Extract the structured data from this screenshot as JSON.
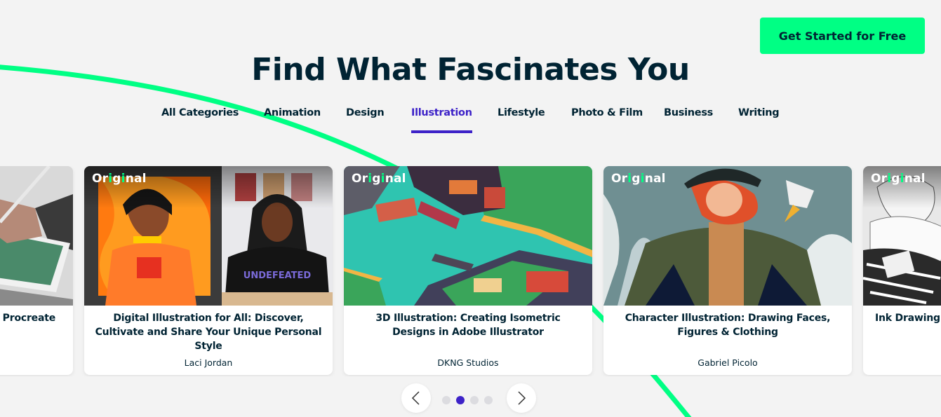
{
  "header": {
    "cta_label": "Get Started for Free",
    "title": "Find What Fascinates You"
  },
  "tabs": [
    {
      "label": "All Categories",
      "active": false
    },
    {
      "label": "Animation",
      "active": false
    },
    {
      "label": "Design",
      "active": false
    },
    {
      "label": "Illustration",
      "active": true
    },
    {
      "label": "Lifestyle",
      "active": false
    },
    {
      "label": "Photo & Film",
      "active": false
    },
    {
      "label": "Business",
      "active": false
    },
    {
      "label": "Writing",
      "active": false
    }
  ],
  "badge": {
    "label": "Original"
  },
  "cards": [
    {
      "title": "… Procreate",
      "author": "",
      "badge": false,
      "image": "hand-drawing-on-tablet"
    },
    {
      "title": "Digital Illustration for All: Discover, Cultivate and Share Your Unique Personal Style",
      "author": "Laci Jordan",
      "badge": true,
      "image": "illustrated-portrait-and-instructor"
    },
    {
      "title": "3D Illustration: Creating Isometric Designs in Adobe Illustrator",
      "author": "DKNG Studios",
      "badge": true,
      "image": "isometric-harbor-city"
    },
    {
      "title": "Character Illustration: Drawing Faces, Figures & Clothing",
      "author": "Gabriel Picolo",
      "badge": true,
      "image": "red-haired-character-in-snow"
    },
    {
      "title": "Ink Drawing T…",
      "author": "",
      "badge": true,
      "image": "ink-drawn-cat-sketch"
    }
  ],
  "pagination": {
    "prev_icon": "chevron-left-icon",
    "next_icon": "chevron-right-icon",
    "pages": 4,
    "current": 2
  },
  "colors": {
    "accent_green": "#00ff84",
    "accent_purple": "#3d22c8",
    "text_dark": "#002333",
    "background": "#f3f3f3"
  }
}
